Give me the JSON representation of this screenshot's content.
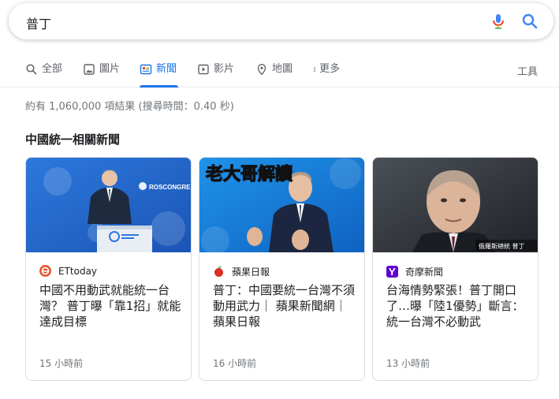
{
  "search": {
    "query": "普丁"
  },
  "tabs": [
    {
      "label": "全部",
      "icon": "search-icon",
      "active": false
    },
    {
      "label": "圖片",
      "icon": "image-icon",
      "active": false
    },
    {
      "label": "新聞",
      "icon": "news-icon",
      "active": true
    },
    {
      "label": "影片",
      "icon": "video-icon",
      "active": false
    },
    {
      "label": "地圖",
      "icon": "map-pin-icon",
      "active": false
    },
    {
      "label": "更多",
      "icon": "more-vert-icon",
      "active": false
    }
  ],
  "tools_label": "工具",
  "result_stats": "約有 1,060,000 項結果 (搜尋時間：0.40 秒)",
  "section_title": "中國統一相關新聞",
  "cards": [
    {
      "source": "ETtoday",
      "headline": "中國不用動武就能統一台灣？ 普丁曝「靠1招」就能達成目標",
      "time": "15 小時前",
      "thumb_text": "ROSCONGRESS"
    },
    {
      "source": "蘋果日報",
      "headline": "普丁：中國要統一台灣不須動用武力｜ 蘋果新聞網｜ 蘋果日報",
      "time": "16 小時前",
      "thumb_text": "老大哥解讀"
    },
    {
      "source": "奇摩新聞",
      "headline": "台海情勢緊張！普丁開口了…曝「陸1優勢」斷言：統一台灣不必動武",
      "time": "13 小時前",
      "thumb_text": "俄羅斯總統 普丁"
    }
  ],
  "colors": {
    "accent": "#1a73e8",
    "ettoday": "#e8542b",
    "apple": "#d93025",
    "yahoo": "#6001d2"
  }
}
